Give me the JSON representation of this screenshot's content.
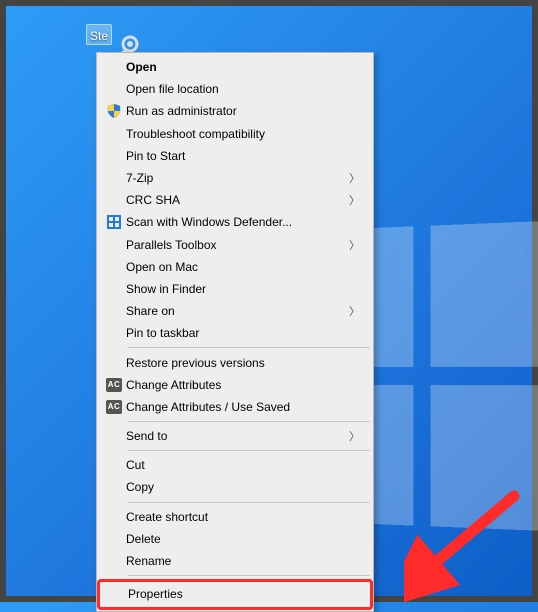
{
  "desktop": {
    "icon_label": "Ste"
  },
  "menu": {
    "open": "Open",
    "open_file_location": "Open file location",
    "run_as_admin": "Run as administrator",
    "troubleshoot": "Troubleshoot compatibility",
    "pin_to_start": "Pin to Start",
    "seven_zip": "7-Zip",
    "crc_sha": "CRC SHA",
    "scan_defender": "Scan with Windows Defender...",
    "parallels_toolbox": "Parallels Toolbox",
    "open_on_mac": "Open on Mac",
    "show_in_finder": "Show in Finder",
    "share_on": "Share on",
    "pin_to_taskbar": "Pin to taskbar",
    "restore_versions": "Restore previous versions",
    "change_attributes": "Change Attributes",
    "change_attributes_saved": "Change Attributes / Use Saved",
    "send_to": "Send to",
    "cut": "Cut",
    "copy": "Copy",
    "create_shortcut": "Create shortcut",
    "delete": "Delete",
    "rename": "Rename",
    "properties": "Properties",
    "ac_badge": "AC"
  }
}
